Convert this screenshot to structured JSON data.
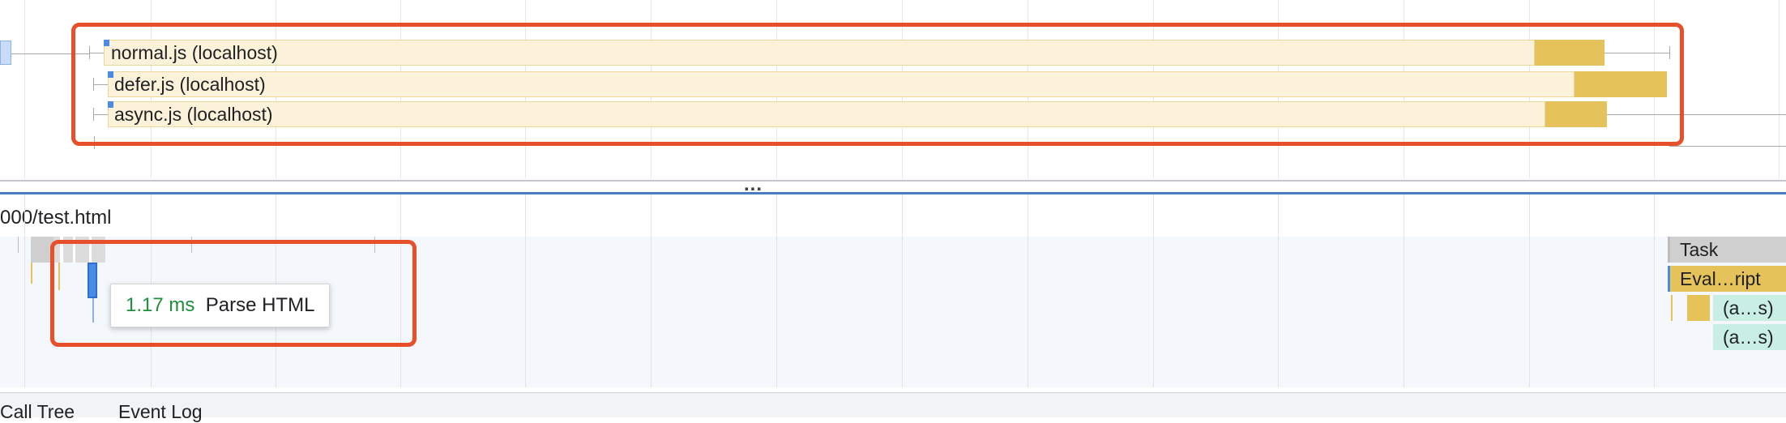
{
  "network": {
    "rows": [
      {
        "label": "normal.js (localhost)"
      },
      {
        "label": "defer.js (localhost)"
      },
      {
        "label": "async.js (localhost)"
      }
    ]
  },
  "divider": {
    "handle": "..."
  },
  "main": {
    "track_title": "000/test.html",
    "tooltip": {
      "duration": "1.17 ms",
      "event": "Parse HTML"
    },
    "flame": {
      "task": "Task",
      "eval": "Eval…ript",
      "anon1": "(a…s)",
      "anon2": "(a…s)"
    }
  },
  "tabs": {
    "call_tree": "Call Tree",
    "event_log": "Event Log"
  },
  "colors": {
    "accent_highlight": "#e8502c",
    "script_light": "#fbf2d9",
    "script_dark": "#e6c25a",
    "tooltip_duration": "#1e8e3e",
    "task_gray": "#cfcfcf",
    "anon_teal": "#c9efe4",
    "selection_blue": "#4a8be8"
  }
}
